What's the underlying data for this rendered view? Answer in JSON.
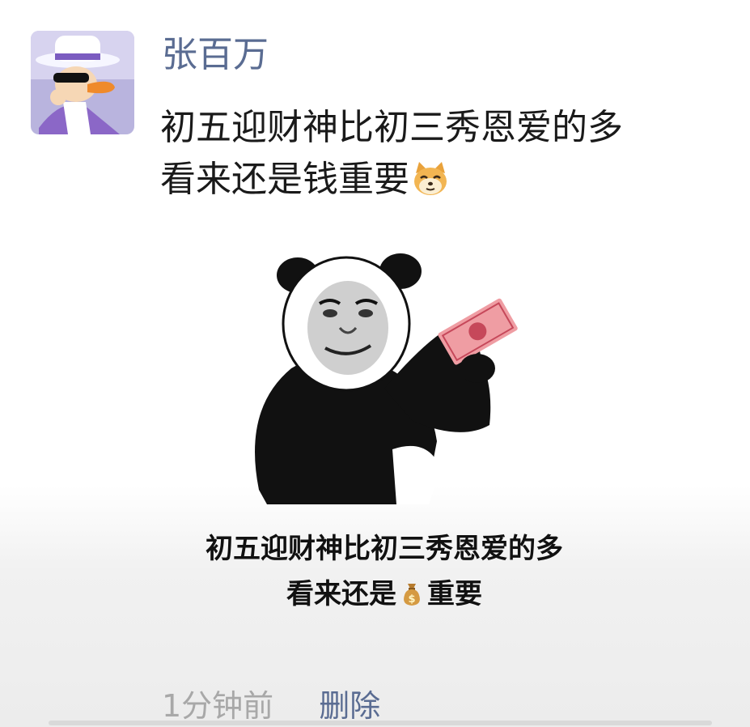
{
  "post": {
    "username": "张百万",
    "text_lines": [
      "初五迎财神比初三秀恩爱的多",
      "看来还是钱重要"
    ],
    "text_emoji": "doge-emoji",
    "avatar_icon": "cartoon-duck-avatar"
  },
  "image": {
    "icon": "panda-meme-holding-money",
    "caption_line1": "初五迎财神比初三秀恩爱的多",
    "caption_line2_prefix": "看来还是",
    "caption_line2_emoji": "money-bag-emoji",
    "caption_line2_suffix": "重要"
  },
  "footer": {
    "timestamp": "1分钟前",
    "delete_label": "删除"
  },
  "colors": {
    "link": "#5a6c92",
    "text": "#1a1a1a",
    "muted": "#a8a8a8"
  }
}
